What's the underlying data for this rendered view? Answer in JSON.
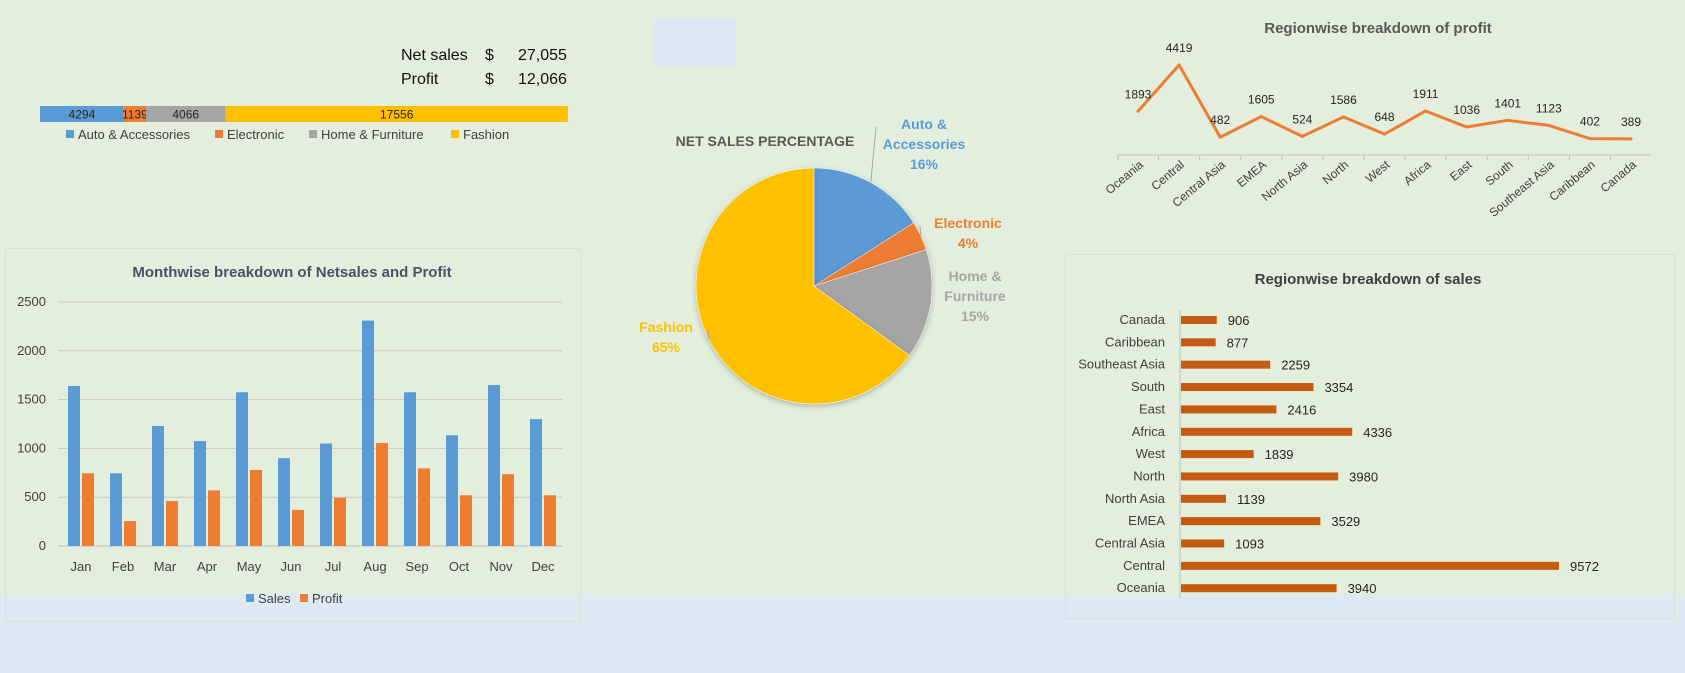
{
  "kpis": {
    "net_sales": {
      "label": "Net sales",
      "currency": "$",
      "value": "27,055"
    },
    "profit": {
      "label": "Profit",
      "currency": "$",
      "value": "12,066"
    }
  },
  "colors": {
    "blue": "#5b9bd5",
    "orange": "#ed7d31",
    "gray": "#a5a5a5",
    "gold": "#ffc000",
    "rust": "#c55a11"
  },
  "chart_data": [
    {
      "type": "bar",
      "orientation": "stacked-horizontal",
      "title": "",
      "series": [
        {
          "name": "Auto & Accessories",
          "values": [
            4294
          ]
        },
        {
          "name": "Electronic",
          "values": [
            1139
          ]
        },
        {
          "name": "Home & Furniture",
          "values": [
            4066
          ]
        },
        {
          "name": "Fashion",
          "values": [
            17556
          ]
        }
      ],
      "legend": "bottom"
    },
    {
      "type": "pie",
      "title": "NET SALES PERCENTAGE",
      "slices": [
        {
          "label": "Auto &\nAccessories",
          "value": 16,
          "pct": "16%"
        },
        {
          "label": "Electronic",
          "value": 4,
          "pct": "4%"
        },
        {
          "label": "Home &\nFurniture",
          "value": 15,
          "pct": "15%"
        },
        {
          "label": "Fashion",
          "value": 65,
          "pct": "65%"
        }
      ]
    },
    {
      "type": "line",
      "title": "Regionwise breakdown of profit",
      "categories": [
        "Oceania",
        "Central",
        "Central Asia",
        "EMEA",
        "North Asia",
        "North",
        "West",
        "Africa",
        "East",
        "South",
        "Southeast Asia",
        "Caribbean",
        "Canada"
      ],
      "values": [
        1893,
        4419,
        482,
        1605,
        524,
        1586,
        648,
        1911,
        1036,
        1401,
        1123,
        402,
        389
      ]
    },
    {
      "type": "bar",
      "title": "Monthwise breakdown of Netsales and Profit",
      "categories": [
        "Jan",
        "Feb",
        "Mar",
        "Apr",
        "May",
        "Jun",
        "Jul",
        "Aug",
        "Sep",
        "Oct",
        "Nov",
        "Dec"
      ],
      "series": [
        {
          "name": "Sales",
          "values": [
            1640,
            745,
            1230,
            1075,
            1575,
            900,
            1050,
            2310,
            1575,
            1135,
            1650,
            1300
          ]
        },
        {
          "name": "Profit",
          "values": [
            745,
            255,
            460,
            570,
            780,
            370,
            495,
            1055,
            795,
            520,
            735,
            520
          ]
        }
      ],
      "ylim": [
        0,
        2500
      ],
      "yticks": [
        "0",
        "500",
        "1000",
        "1500",
        "2000",
        "2500"
      ],
      "grid": true,
      "legend": "bottom"
    },
    {
      "type": "bar",
      "orientation": "horizontal",
      "title": "Regionwise breakdown of sales",
      "categories": [
        "Canada",
        "Caribbean",
        "Southeast Asia",
        "South",
        "East",
        "Africa",
        "West",
        "North",
        "North Asia",
        "EMEA",
        "Central Asia",
        "Central",
        "Oceania"
      ],
      "values": [
        906,
        877,
        2259,
        3354,
        2416,
        4336,
        1839,
        3980,
        1139,
        3529,
        1093,
        9572,
        3940
      ]
    }
  ]
}
